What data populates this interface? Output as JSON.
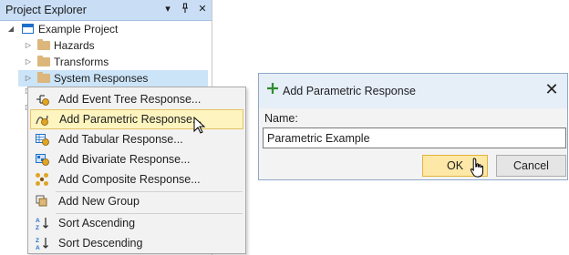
{
  "explorer": {
    "title": "Project Explorer",
    "title_icons": [
      "dropdown-arrow-icon",
      "pin-icon",
      "close-icon"
    ],
    "tree": {
      "project": "Example Project",
      "items": [
        {
          "label": "Hazards",
          "icon": "folder-icon"
        },
        {
          "label": "Transforms",
          "icon": "folder-icon"
        },
        {
          "label": "System Responses",
          "icon": "folder-icon",
          "selected": true
        }
      ]
    }
  },
  "context_menu": {
    "items": [
      {
        "label": "Add Event Tree Response...",
        "icon": "event-tree-response-icon"
      },
      {
        "label": "Add Parametric Response...",
        "icon": "parametric-response-icon",
        "highlighted": true
      },
      {
        "label": "Add Tabular Response...",
        "icon": "tabular-response-icon"
      },
      {
        "label": "Add Bivariate Response...",
        "icon": "bivariate-response-icon"
      },
      {
        "label": "Add Composite Response...",
        "icon": "composite-response-icon"
      },
      {
        "label": "Add New Group",
        "icon": "new-group-icon"
      },
      {
        "label": "Sort Ascending",
        "icon": "sort-ascending-icon"
      },
      {
        "label": "Sort Descending",
        "icon": "sort-descending-icon"
      }
    ]
  },
  "dialog": {
    "title": "Add Parametric Response",
    "name_label": "Name:",
    "name_value": "Parametric Example",
    "ok_label": "OK",
    "cancel_label": "Cancel"
  },
  "colors": {
    "panel_title_bg": "#c9def5",
    "selection": "#cce4f7",
    "menu_highlight": "#fdf4bf",
    "ok_button": "#fde8a8",
    "accent_green": "#2e8b2e"
  }
}
